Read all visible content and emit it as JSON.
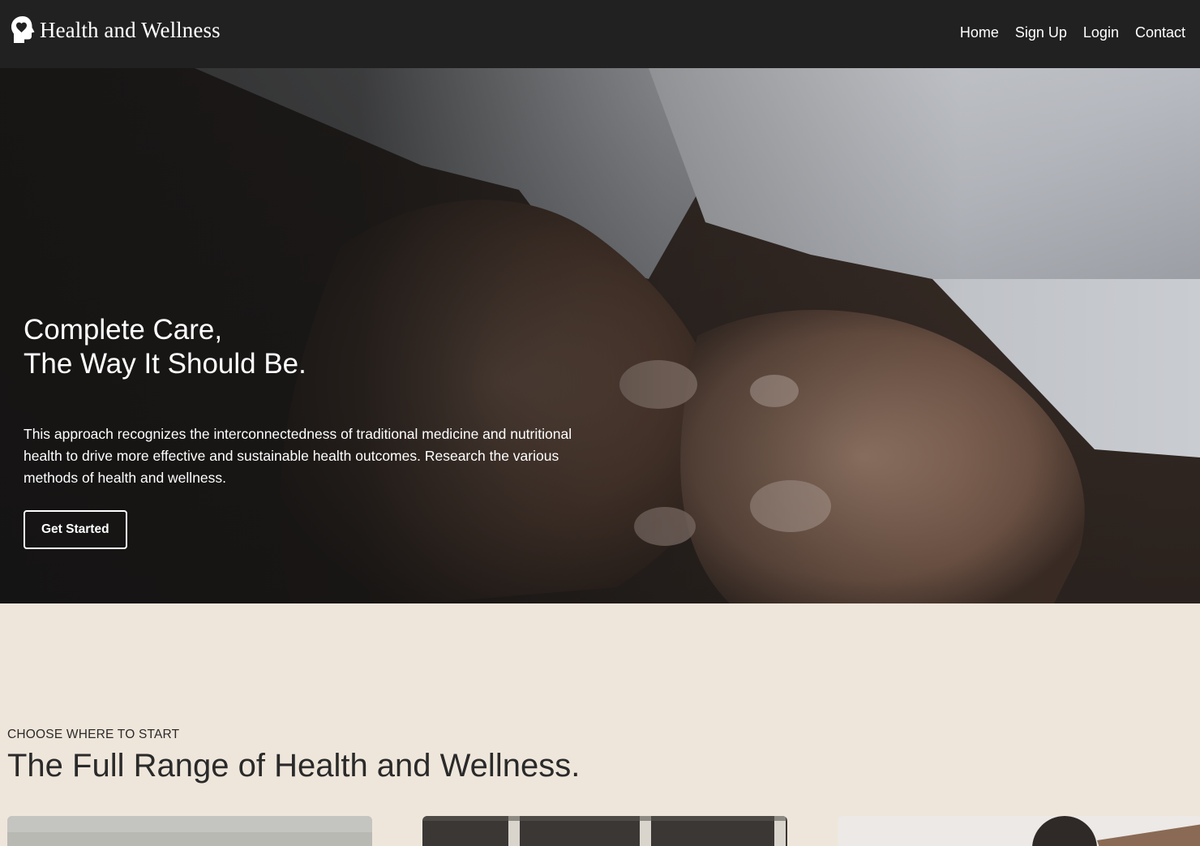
{
  "nav": {
    "brand": "Health and Wellness",
    "brand_icon": "head-heart-icon",
    "links": [
      "Home",
      "Sign Up",
      "Login",
      "Contact"
    ]
  },
  "hero": {
    "title_line1": "Complete Care,",
    "title_line2": "The Way It Should Be.",
    "description": "This approach recognizes the interconnectedness of traditional medicine and nutritional health to drive more effective and sustainable health outcomes. Research the various methods of health and wellness.",
    "cta": "Get Started"
  },
  "section": {
    "eyebrow": "CHOOSE WHERE TO START",
    "title": "The Full Range of Health and Wellness."
  },
  "colors": {
    "nav_bg": "#212121",
    "section_bg": "#efe6db",
    "text_light": "#ffffff",
    "text_dark": "#2a2a2a"
  }
}
